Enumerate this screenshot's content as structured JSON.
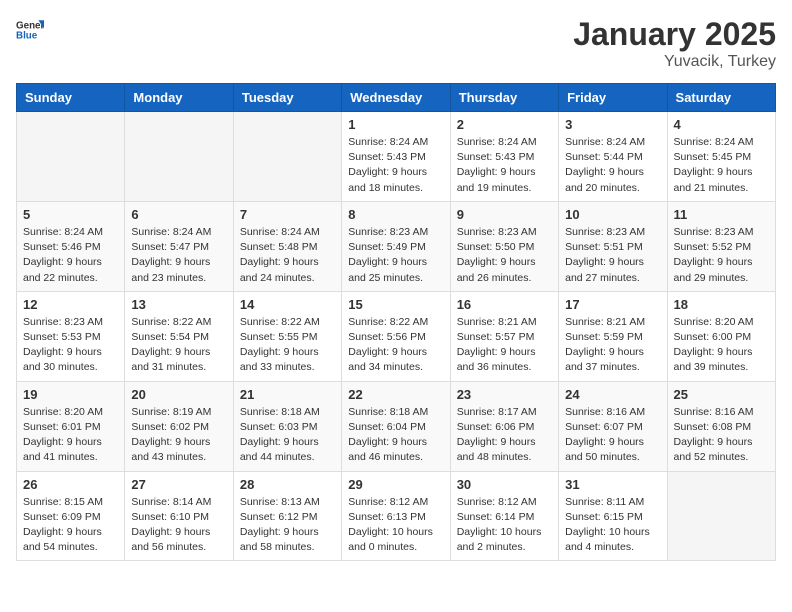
{
  "logo": {
    "text_general": "General",
    "text_blue": "Blue"
  },
  "header": {
    "month": "January 2025",
    "location": "Yuvacik, Turkey"
  },
  "weekdays": [
    "Sunday",
    "Monday",
    "Tuesday",
    "Wednesday",
    "Thursday",
    "Friday",
    "Saturday"
  ],
  "weeks": [
    [
      {
        "day": "",
        "info": ""
      },
      {
        "day": "",
        "info": ""
      },
      {
        "day": "",
        "info": ""
      },
      {
        "day": "1",
        "info": "Sunrise: 8:24 AM\nSunset: 5:43 PM\nDaylight: 9 hours\nand 18 minutes."
      },
      {
        "day": "2",
        "info": "Sunrise: 8:24 AM\nSunset: 5:43 PM\nDaylight: 9 hours\nand 19 minutes."
      },
      {
        "day": "3",
        "info": "Sunrise: 8:24 AM\nSunset: 5:44 PM\nDaylight: 9 hours\nand 20 minutes."
      },
      {
        "day": "4",
        "info": "Sunrise: 8:24 AM\nSunset: 5:45 PM\nDaylight: 9 hours\nand 21 minutes."
      }
    ],
    [
      {
        "day": "5",
        "info": "Sunrise: 8:24 AM\nSunset: 5:46 PM\nDaylight: 9 hours\nand 22 minutes."
      },
      {
        "day": "6",
        "info": "Sunrise: 8:24 AM\nSunset: 5:47 PM\nDaylight: 9 hours\nand 23 minutes."
      },
      {
        "day": "7",
        "info": "Sunrise: 8:24 AM\nSunset: 5:48 PM\nDaylight: 9 hours\nand 24 minutes."
      },
      {
        "day": "8",
        "info": "Sunrise: 8:23 AM\nSunset: 5:49 PM\nDaylight: 9 hours\nand 25 minutes."
      },
      {
        "day": "9",
        "info": "Sunrise: 8:23 AM\nSunset: 5:50 PM\nDaylight: 9 hours\nand 26 minutes."
      },
      {
        "day": "10",
        "info": "Sunrise: 8:23 AM\nSunset: 5:51 PM\nDaylight: 9 hours\nand 27 minutes."
      },
      {
        "day": "11",
        "info": "Sunrise: 8:23 AM\nSunset: 5:52 PM\nDaylight: 9 hours\nand 29 minutes."
      }
    ],
    [
      {
        "day": "12",
        "info": "Sunrise: 8:23 AM\nSunset: 5:53 PM\nDaylight: 9 hours\nand 30 minutes."
      },
      {
        "day": "13",
        "info": "Sunrise: 8:22 AM\nSunset: 5:54 PM\nDaylight: 9 hours\nand 31 minutes."
      },
      {
        "day": "14",
        "info": "Sunrise: 8:22 AM\nSunset: 5:55 PM\nDaylight: 9 hours\nand 33 minutes."
      },
      {
        "day": "15",
        "info": "Sunrise: 8:22 AM\nSunset: 5:56 PM\nDaylight: 9 hours\nand 34 minutes."
      },
      {
        "day": "16",
        "info": "Sunrise: 8:21 AM\nSunset: 5:57 PM\nDaylight: 9 hours\nand 36 minutes."
      },
      {
        "day": "17",
        "info": "Sunrise: 8:21 AM\nSunset: 5:59 PM\nDaylight: 9 hours\nand 37 minutes."
      },
      {
        "day": "18",
        "info": "Sunrise: 8:20 AM\nSunset: 6:00 PM\nDaylight: 9 hours\nand 39 minutes."
      }
    ],
    [
      {
        "day": "19",
        "info": "Sunrise: 8:20 AM\nSunset: 6:01 PM\nDaylight: 9 hours\nand 41 minutes."
      },
      {
        "day": "20",
        "info": "Sunrise: 8:19 AM\nSunset: 6:02 PM\nDaylight: 9 hours\nand 43 minutes."
      },
      {
        "day": "21",
        "info": "Sunrise: 8:18 AM\nSunset: 6:03 PM\nDaylight: 9 hours\nand 44 minutes."
      },
      {
        "day": "22",
        "info": "Sunrise: 8:18 AM\nSunset: 6:04 PM\nDaylight: 9 hours\nand 46 minutes."
      },
      {
        "day": "23",
        "info": "Sunrise: 8:17 AM\nSunset: 6:06 PM\nDaylight: 9 hours\nand 48 minutes."
      },
      {
        "day": "24",
        "info": "Sunrise: 8:16 AM\nSunset: 6:07 PM\nDaylight: 9 hours\nand 50 minutes."
      },
      {
        "day": "25",
        "info": "Sunrise: 8:16 AM\nSunset: 6:08 PM\nDaylight: 9 hours\nand 52 minutes."
      }
    ],
    [
      {
        "day": "26",
        "info": "Sunrise: 8:15 AM\nSunset: 6:09 PM\nDaylight: 9 hours\nand 54 minutes."
      },
      {
        "day": "27",
        "info": "Sunrise: 8:14 AM\nSunset: 6:10 PM\nDaylight: 9 hours\nand 56 minutes."
      },
      {
        "day": "28",
        "info": "Sunrise: 8:13 AM\nSunset: 6:12 PM\nDaylight: 9 hours\nand 58 minutes."
      },
      {
        "day": "29",
        "info": "Sunrise: 8:12 AM\nSunset: 6:13 PM\nDaylight: 10 hours\nand 0 minutes."
      },
      {
        "day": "30",
        "info": "Sunrise: 8:12 AM\nSunset: 6:14 PM\nDaylight: 10 hours\nand 2 minutes."
      },
      {
        "day": "31",
        "info": "Sunrise: 8:11 AM\nSunset: 6:15 PM\nDaylight: 10 hours\nand 4 minutes."
      },
      {
        "day": "",
        "info": ""
      }
    ]
  ]
}
